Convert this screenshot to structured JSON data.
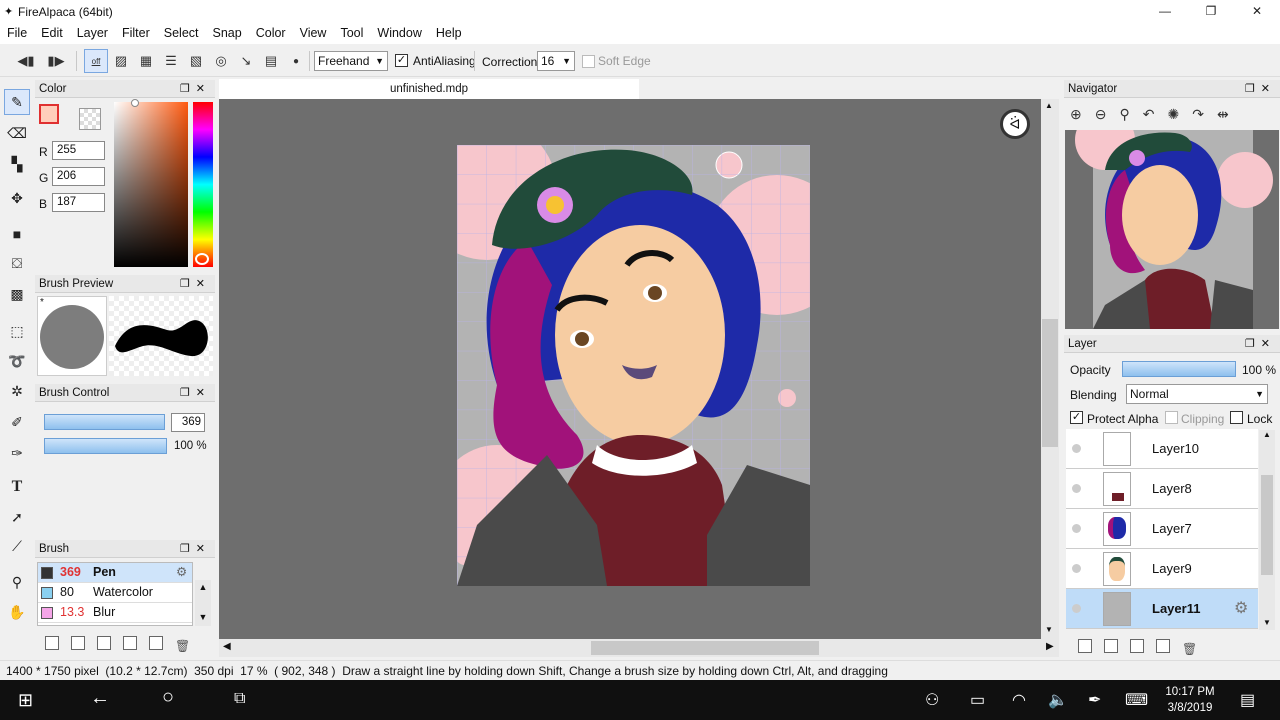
{
  "app": {
    "title": "FireAlpaca (64bit)"
  },
  "menu": [
    "File",
    "Edit",
    "Layer",
    "Filter",
    "Select",
    "Snap",
    "Color",
    "View",
    "Tool",
    "Window",
    "Help"
  ],
  "toolbar": {
    "snap_off": "off",
    "stroke_mode": "Freehand",
    "antialiasing_label": "AntiAliasing",
    "antialiasing_checked": true,
    "correction_label": "Correction",
    "correction_value": "16",
    "soft_edge_label": "Soft Edge",
    "soft_edge_checked": false
  },
  "color_panel": {
    "title": "Color",
    "r_label": "R",
    "r": "255",
    "g_label": "G",
    "g": "206",
    "b_label": "B",
    "b": "187",
    "current_color": "#ffcebb"
  },
  "brush_preview": {
    "title": "Brush Preview",
    "marker": "*"
  },
  "brush_control": {
    "title": "Brush Control",
    "size": "369",
    "opacity": "100 %",
    "size_fraction": 0.9,
    "opacity_fraction": 1.0
  },
  "brush_panel": {
    "title": "Brush",
    "items": [
      {
        "size": "369",
        "name": "Pen",
        "color": "#333333"
      },
      {
        "size": "80",
        "name": "Watercolor",
        "color": "#8ad0f0"
      },
      {
        "size": "13.3",
        "name": "Blur",
        "color": "#f5a5e8"
      }
    ]
  },
  "document": {
    "tab": "unfinished.mdp"
  },
  "navigator": {
    "title": "Navigator"
  },
  "layer_panel": {
    "title": "Layer",
    "opacity_label": "Opacity",
    "opacity": "100 %",
    "blending_label": "Blending",
    "blending": "Normal",
    "protect_alpha": "Protect Alpha",
    "clipping": "Clipping",
    "lock": "Lock",
    "layers": [
      {
        "name": "Layer10",
        "selected": false
      },
      {
        "name": "Layer8",
        "selected": false
      },
      {
        "name": "Layer7",
        "selected": false
      },
      {
        "name": "Layer9",
        "selected": false
      },
      {
        "name": "Layer11",
        "selected": true
      }
    ]
  },
  "status": {
    "text": "1400 * 1750 pixel  (10.2 * 12.7cm)  350 dpi  17 %  ( 902, 348 )  Draw a straight line by holding down Shift, Change a brush size by holding down Ctrl, Alt, and dragging"
  },
  "taskbar": {
    "time": "10:17 PM",
    "date": "3/8/2019"
  }
}
